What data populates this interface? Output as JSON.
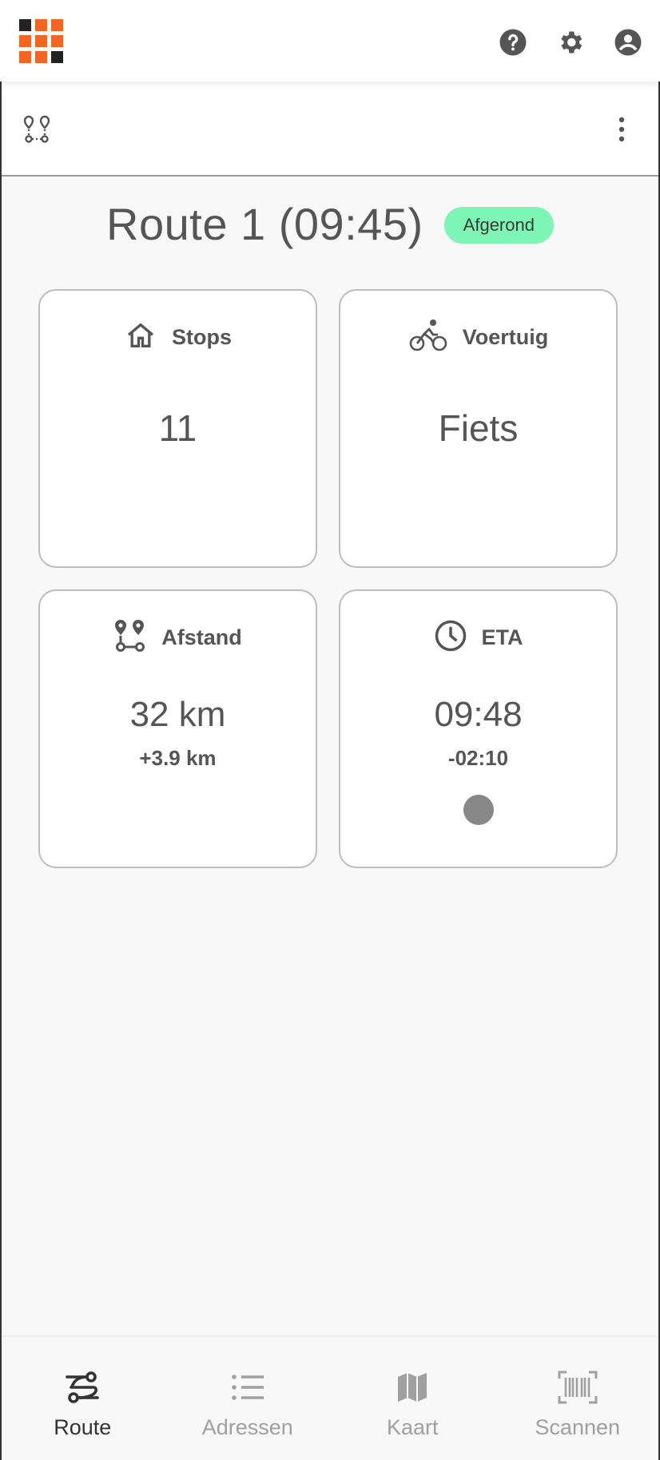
{
  "header": {
    "logo_name": "grid-logo",
    "logo_colors": {
      "dark": "#222222",
      "orange": "#f26522"
    },
    "icons": [
      "help-icon",
      "settings-icon",
      "account-icon"
    ]
  },
  "toolbar": {
    "left_icon": "route-icon",
    "right_icon": "more-vertical-icon"
  },
  "route": {
    "title": "Route 1 (09:45)",
    "status": "Afgerond",
    "status_color": "#7df5b5"
  },
  "cards": {
    "stops": {
      "label": "Stops",
      "value": "11",
      "icon": "home-icon"
    },
    "vehicle": {
      "label": "Voertuig",
      "value": "Fiets",
      "icon": "bike-icon"
    },
    "distance": {
      "label": "Afstand",
      "value": "32 km",
      "sub": "+3.9 km",
      "icon": "route-pins-icon"
    },
    "eta": {
      "label": "ETA",
      "value": "09:48",
      "sub": "-02:10",
      "icon": "clock-icon",
      "indicator_color": "#878787"
    }
  },
  "nav": {
    "items": [
      {
        "label": "Route",
        "icon": "route-icon",
        "active": true
      },
      {
        "label": "Adressen",
        "icon": "list-icon",
        "active": false
      },
      {
        "label": "Kaart",
        "icon": "map-icon",
        "active": false
      },
      {
        "label": "Scannen",
        "icon": "barcode-icon",
        "active": false
      }
    ]
  }
}
